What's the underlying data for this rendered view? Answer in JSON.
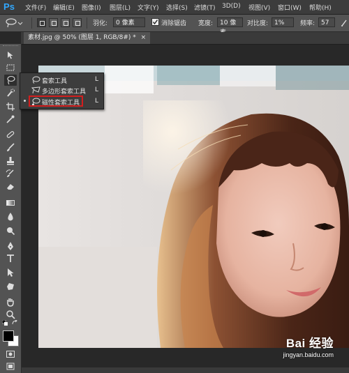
{
  "app": {
    "logo": "Ps"
  },
  "menu": [
    "文件(F)",
    "编辑(E)",
    "图像(I)",
    "图层(L)",
    "文字(Y)",
    "选择(S)",
    "滤镜(T)",
    "3D(D)",
    "视图(V)",
    "窗口(W)",
    "帮助(H)"
  ],
  "options": {
    "feather_label": "羽化:",
    "feather_value": "0 像素",
    "antialias_label": "消除锯齿",
    "width_label": "宽度:",
    "width_value": "10 像素",
    "contrast_label": "对比度:",
    "contrast_value": "1%",
    "frequency_label": "频率:",
    "frequency_value": "57"
  },
  "document": {
    "tab_title": "素材.jpg @ 50% (图层 1, RGB/8#) *",
    "close": "×"
  },
  "flyout": {
    "items": [
      {
        "label": "套索工具",
        "shortcut": "L"
      },
      {
        "label": "多边形套索工具",
        "shortcut": "L"
      },
      {
        "label": "磁性套索工具",
        "shortcut": "L"
      }
    ],
    "highlight_color": "#d21e1e"
  },
  "watermark": {
    "logo": "Bai 经验",
    "url": "jingyan.baidu.com"
  },
  "colors": {
    "accent": "#31a8ff",
    "panel": "#535353",
    "background": "#282828"
  }
}
